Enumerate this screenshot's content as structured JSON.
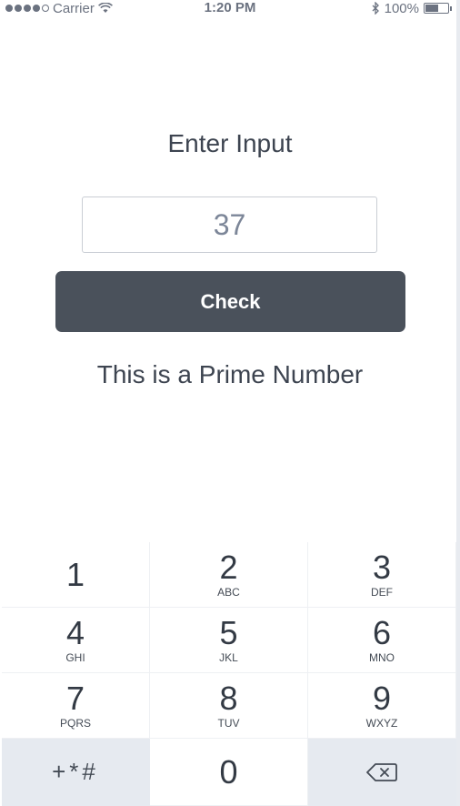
{
  "status_bar": {
    "carrier": "Carrier",
    "time": "1:20 PM",
    "battery": "100%"
  },
  "screen": {
    "title": "Enter Input",
    "input_value": "37",
    "check_label": "Check",
    "result": "This is a Prime Number"
  },
  "keypad": {
    "keys": [
      {
        "num": "1",
        "letters": ""
      },
      {
        "num": "2",
        "letters": "ABC"
      },
      {
        "num": "3",
        "letters": "DEF"
      },
      {
        "num": "4",
        "letters": "GHI"
      },
      {
        "num": "5",
        "letters": "JKL"
      },
      {
        "num": "6",
        "letters": "MNO"
      },
      {
        "num": "7",
        "letters": "PQRS"
      },
      {
        "num": "8",
        "letters": "TUV"
      },
      {
        "num": "9",
        "letters": "WXYZ"
      },
      {
        "num": "0",
        "letters": ""
      }
    ],
    "symbols": "+*#",
    "delete_icon": "backspace-icon"
  }
}
